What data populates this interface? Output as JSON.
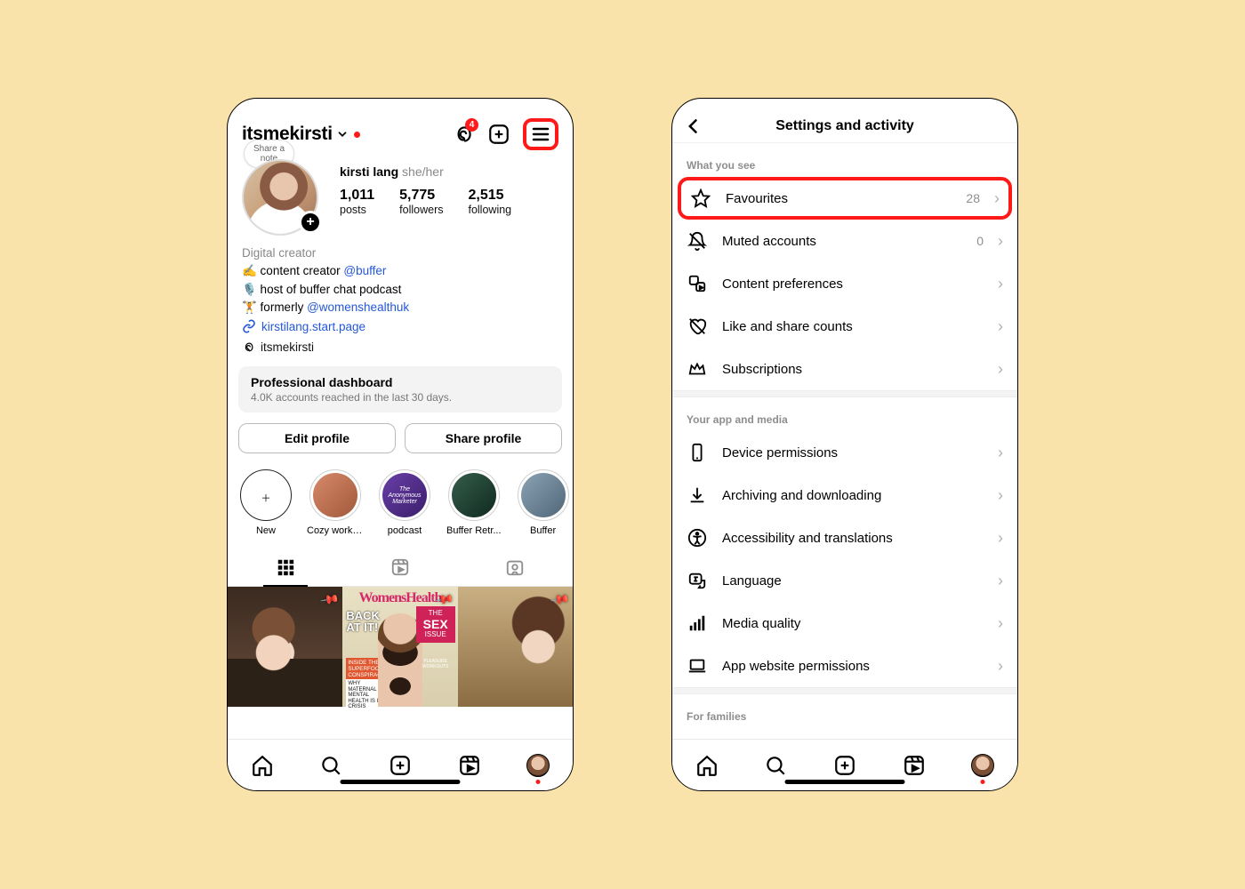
{
  "profile": {
    "header": {
      "username": "itsmekirsti",
      "threads_badge": 4
    },
    "note_hint": "Share a\nnote",
    "display_name": "kirsti lang",
    "pronouns": "she/her",
    "stats": {
      "posts": {
        "value": "1,011",
        "label": "posts"
      },
      "followers": {
        "value": "5,775",
        "label": "followers"
      },
      "following": {
        "value": "2,515",
        "label": "following"
      }
    },
    "bio": {
      "category": "Digital creator",
      "line1_a": "✍️ content creator ",
      "line1_mention": "@buffer",
      "line2": "🎙️ host of buffer chat podcast",
      "line3_a": "🏋️ formerly ",
      "line3_mention": "@womenshealthuk",
      "link": "kirstilang.start.page",
      "threads_handle": "itsmekirsti"
    },
    "pro_dashboard": {
      "title": "Professional dashboard",
      "subtitle": "4.0K accounts reached in the last 30 days."
    },
    "buttons": {
      "edit": "Edit profile",
      "share": "Share profile"
    },
    "highlights": [
      {
        "label": "New",
        "kind": "add"
      },
      {
        "label": "Cozy working",
        "kind": "img",
        "colors": [
          "#d78a6a",
          "#a1583a"
        ]
      },
      {
        "label": "podcast",
        "kind": "img",
        "colors": [
          "#6a3fa8",
          "#3a1e6b"
        ],
        "text": "The Anonymous Marketer"
      },
      {
        "label": "Buffer Retr...",
        "kind": "img",
        "colors": [
          "#355d4c",
          "#102a1f"
        ]
      },
      {
        "label": "Buffer",
        "kind": "img",
        "colors": [
          "#8ba2b4",
          "#50677a"
        ]
      }
    ],
    "post2": {
      "masthead": "WomensHealth",
      "headline_a": "BACK",
      "headline_b": "AT IT!",
      "right_pre": "THE",
      "right_big": "SEX",
      "right_post": "ISSUE",
      "right_sub": "PLEASURE WORKOUTS",
      "orange": "INSIDE THE SUPERFOOD CONSPIRACY",
      "white": "WHY MATERNAL MENTAL HEALTH IS IN CRISIS"
    }
  },
  "settings": {
    "title": "Settings and activity",
    "sections": {
      "see": {
        "label": "What you see",
        "favourites": {
          "label": "Favourites",
          "count": 28
        },
        "muted": {
          "label": "Muted accounts",
          "count": 0
        },
        "prefs": {
          "label": "Content preferences"
        },
        "likes": {
          "label": "Like and share counts"
        },
        "subs": {
          "label": "Subscriptions"
        }
      },
      "app": {
        "label": "Your app and media",
        "device": {
          "label": "Device permissions"
        },
        "archive": {
          "label": "Archiving and downloading"
        },
        "access": {
          "label": "Accessibility and translations"
        },
        "lang": {
          "label": "Language"
        },
        "media": {
          "label": "Media quality"
        },
        "web": {
          "label": "App website permissions"
        }
      },
      "families": {
        "label": "For families"
      }
    }
  }
}
